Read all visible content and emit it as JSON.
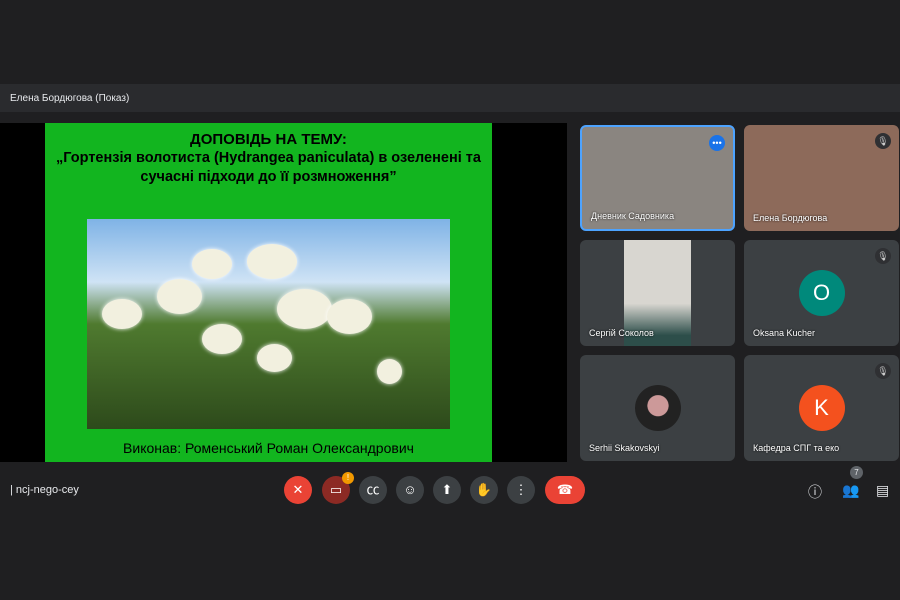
{
  "presenter_bar": "Елена Бордюгова (Показ)",
  "slide": {
    "title": "ДОПОВІДЬ НА ТЕМУ:",
    "subtitle": "„Гортензія волотиста (Hydrangea paniculata) в озеленені та сучасні підходи до її розмноження”",
    "author": "Виконав: Роменський Роман Олександрович"
  },
  "participants": [
    {
      "name": "Дневник Садовника",
      "active": true
    },
    {
      "name": "Елена Бордюгова",
      "muted": true
    },
    {
      "name": "Сергій Соколов"
    },
    {
      "name": "Oksana Kucher",
      "initial": "O",
      "color": "#00897b",
      "muted": true
    },
    {
      "name": "Serhii Skakovskyi"
    },
    {
      "name": "Кафедра СПГ та еко",
      "initial": "K",
      "color": "#f4511e",
      "muted": true
    }
  ],
  "meeting_code": "ncj-nego-cey",
  "participant_count": "7",
  "controls": {
    "alert_badge": "!"
  }
}
